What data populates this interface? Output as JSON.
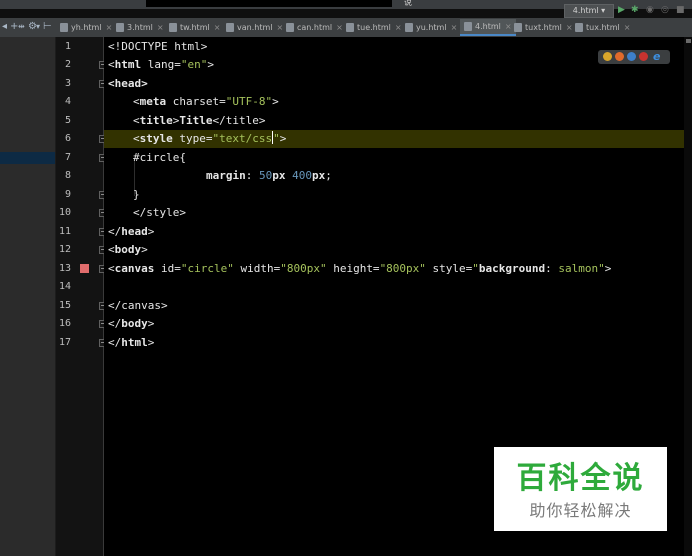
{
  "window": {
    "title_fragment": "说"
  },
  "tabs": [
    {
      "label": "yh.html",
      "active": false
    },
    {
      "label": "3.html",
      "active": false
    },
    {
      "label": "tw.html",
      "active": false
    },
    {
      "label": "van.html",
      "active": false
    },
    {
      "label": "can.html",
      "active": false
    },
    {
      "label": "tue.html",
      "active": false
    },
    {
      "label": "yu.html",
      "active": false
    },
    {
      "label": "4.html",
      "active": true
    },
    {
      "label": "tuxt.html",
      "active": false
    },
    {
      "label": "tux.html",
      "active": false
    }
  ],
  "run_config": {
    "label": "4.html ▾"
  },
  "editor": {
    "line_numbers": [
      "1",
      "2",
      "3",
      "4",
      "5",
      "6",
      "7",
      "8",
      "9",
      "10",
      "11",
      "12",
      "13",
      "14",
      "15",
      "16",
      "17"
    ],
    "current_line": 6,
    "breakpoint_line": 13
  },
  "code": {
    "l1": "<!DOCTYPE html>",
    "l2_open": "<",
    "l2_tag": "html",
    "l2_attr": " lang=",
    "l2_val": "\"en\"",
    "l2_close": ">",
    "l3": "<head>",
    "l4_open": "<",
    "l4_tag": "meta",
    "l4_attr": " charset=",
    "l4_val": "\"UTF-8\"",
    "l4_close": ">",
    "l5_a": "<",
    "l5_tag": "title",
    "l5_b": ">",
    "l5_text": "Title",
    "l5_c": "</title>",
    "l6_open": "<",
    "l6_tag": "style",
    "l6_attr": " type=",
    "l6_val": "\"text/css",
    "l6_q": "\"",
    "l6_close": ">",
    "l7": "#circle{",
    "l8_prop": "margin",
    "l8_colon": ": ",
    "l8_n1": "50",
    "l8_u1": "px",
    "l8_sp": " ",
    "l8_n2": "400",
    "l8_u2": "px",
    "l8_semi": ";",
    "l9": "}",
    "l10": "</style>",
    "l11_a": "</",
    "l11_tag": "head",
    "l11_b": ">",
    "l12_a": "<",
    "l12_tag": "body",
    "l12_b": ">",
    "l13_a": "<",
    "l13_tag": "canvas",
    "l13_id": " id=",
    "l13_idv": "\"circle\"",
    "l13_w": " width=",
    "l13_wv": "\"800px\"",
    "l13_h": " height=",
    "l13_hv": "\"800px\"",
    "l13_s": " style=",
    "l13_sq1": "\"",
    "l13_sp": "background",
    "l13_sc": ": ",
    "l13_sv": "salmon",
    "l13_sq2": "\"",
    "l13_b": ">",
    "l15": "</canvas>",
    "l16_a": "</",
    "l16_tag": "body",
    "l16_b": ">",
    "l17_a": "</",
    "l17_tag": "html",
    "l17_b": ">"
  },
  "watermark": {
    "title": "百科全说",
    "subtitle": "助你轻松解决"
  },
  "colors": {
    "tag": "#e8bf6a",
    "string": "#a5c25c",
    "number": "#6897bb",
    "current_line": "#323200",
    "watermark_green": "#2eaa3b"
  }
}
